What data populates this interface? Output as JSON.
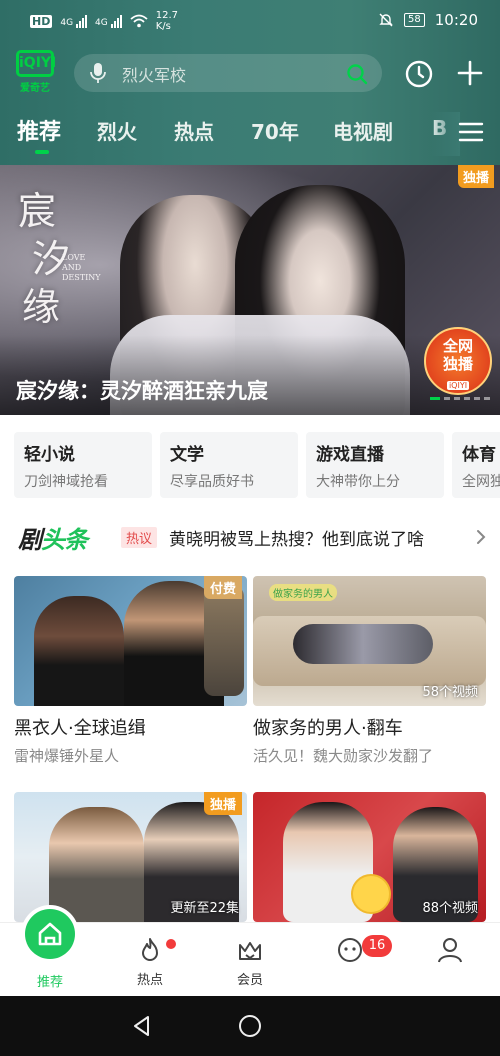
{
  "status_bar": {
    "network_left": "HD",
    "signal1": "4G",
    "signal2": "4G",
    "speed": "12.7",
    "speed_unit": "K/s",
    "battery": "58",
    "time": "10:20"
  },
  "app": {
    "logo_text": "iQIYI",
    "logo_sub": "爱奇艺",
    "search_placeholder": "烈火军校"
  },
  "tabs": [
    {
      "label": "推荐"
    },
    {
      "label": "烈火"
    },
    {
      "label": "热点"
    },
    {
      "label": "70年"
    },
    {
      "label": "电视剧"
    },
    {
      "label": "B"
    }
  ],
  "hero": {
    "calligraphy": [
      "宸",
      "汐",
      "缘"
    ],
    "subtitle_en": "LOVE AND DESTINY",
    "badge_top": "独播",
    "badge_circle_l1": "全网",
    "badge_circle_l2": "独播",
    "badge_circle_logo": "iQIYI",
    "title": "宸汐缘：灵汐醉酒狂亲九宸"
  },
  "categories": [
    {
      "name": "轻小说",
      "desc": "刀剑神域抢看"
    },
    {
      "name": "文学",
      "desc": "尽享品质好书"
    },
    {
      "name": "游戏直播",
      "desc": "大神带你上分"
    },
    {
      "name": "体育",
      "desc": "全网独"
    }
  ],
  "headline": {
    "brand_part1": "剧",
    "brand_part2": "头条",
    "tag": "热议",
    "text": "黄晓明被骂上热搜？他到底说了啥"
  },
  "videos": [
    {
      "title": "黑衣人·全球追缉",
      "sub": "雷神爆锤外星人",
      "tag": "付费",
      "count": ""
    },
    {
      "title": "做家务的男人·翻车",
      "sub": "活久见！魏大勋家沙发翻了",
      "tag": "",
      "count": "58个视频",
      "thumb_brand": "做家务的男人"
    },
    {
      "title": "",
      "sub": "",
      "tag": "独播",
      "count": "更新至22集"
    },
    {
      "title": "",
      "sub": "",
      "tag": "",
      "count": "88个视频"
    }
  ],
  "bottom_nav": {
    "home": "推荐",
    "hot": "热点",
    "vip": "会员",
    "msg_badge": "16",
    "me": ""
  },
  "colors": {
    "brand_green": "#00cf43",
    "nav_green": "#1fc95f",
    "header_bg": "#3b7c74",
    "exclusive_orange": "#f29c1f",
    "alert_red": "#f23b3b"
  }
}
